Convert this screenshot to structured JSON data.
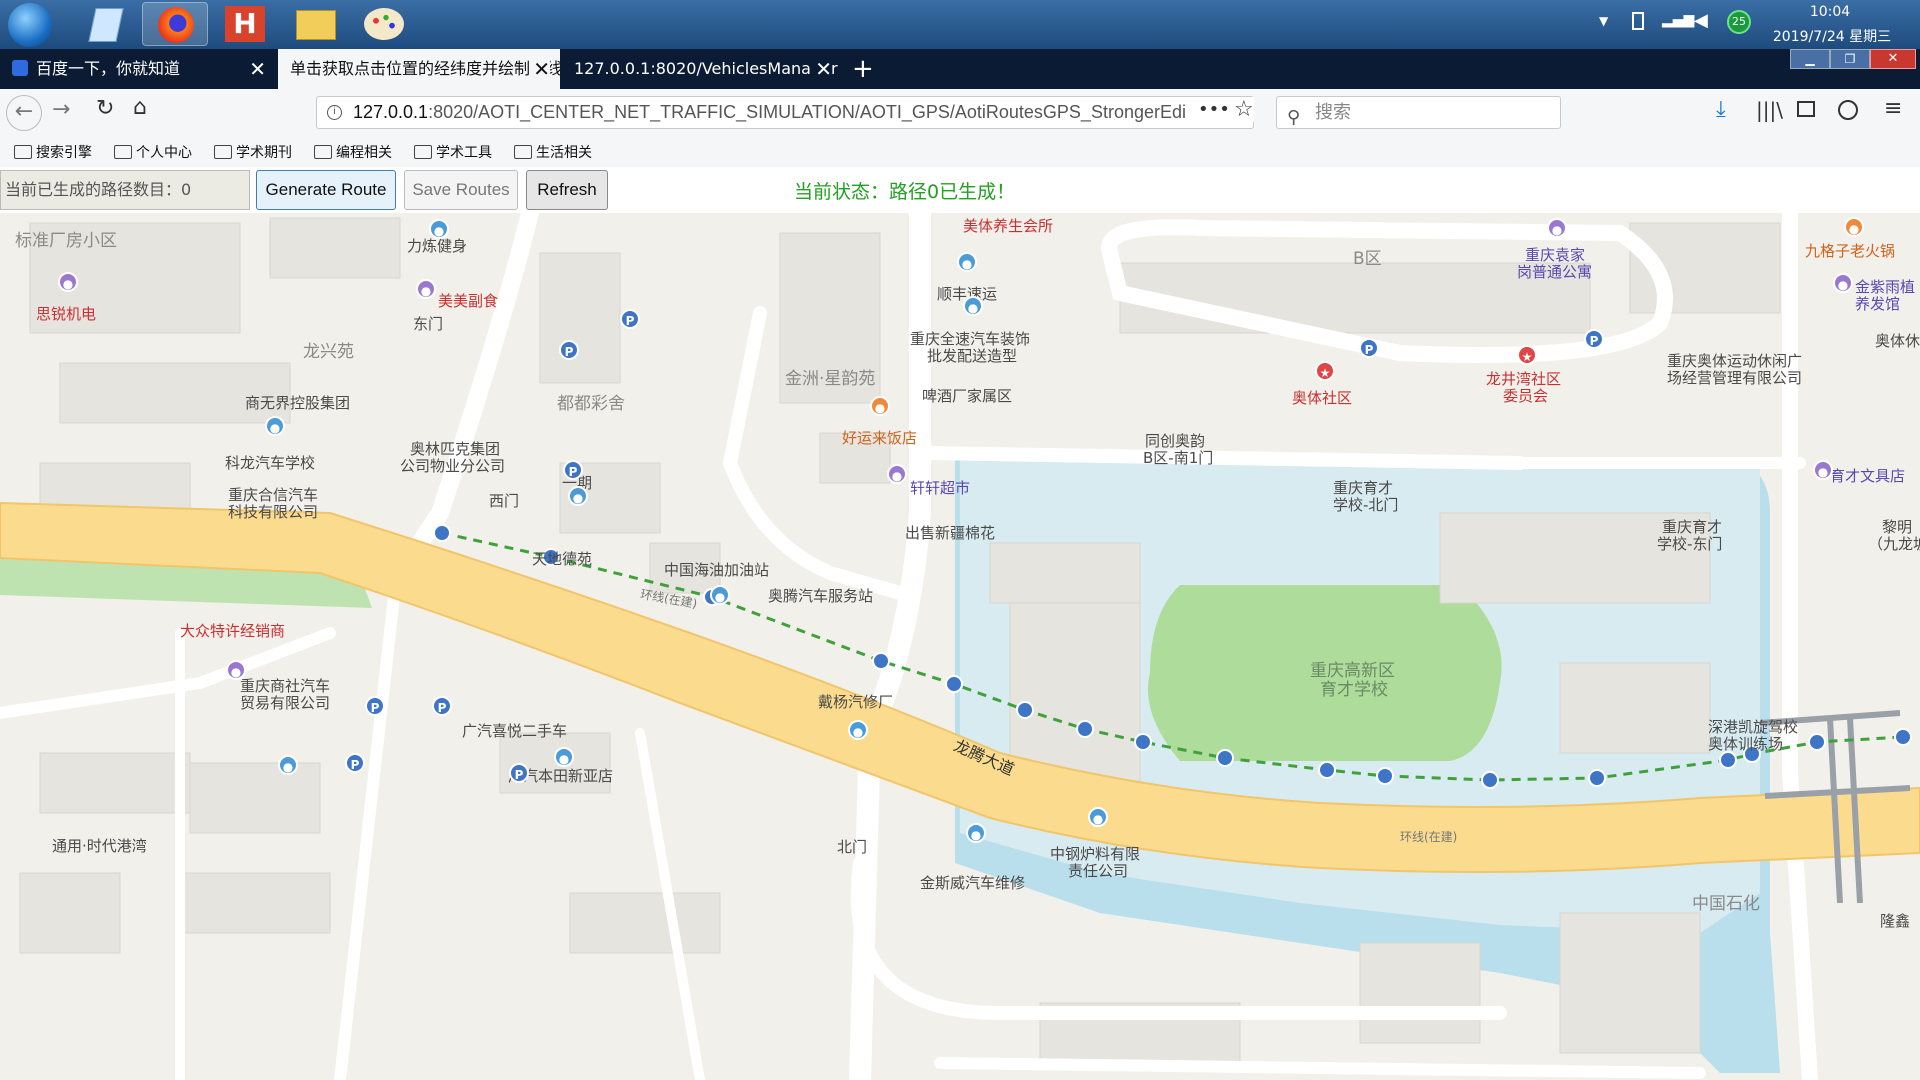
{
  "taskbar": {
    "clock_time": "10:04",
    "clock_date": "2019/7/24 星期三",
    "badge_count": "25"
  },
  "browser": {
    "tabs": [
      {
        "label": "百度一下，你就知道"
      },
      {
        "label": "单击获取点击位置的经纬度并绘制折线"
      },
      {
        "label": "127.0.0.1:8020/VehiclesManager"
      }
    ],
    "url_host": "127.0.0.1",
    "url_rest": ":8020/AOTI_CENTER_NET_TRAFFIC_SIMULATION/AOTI_GPS/AotiRoutesGPS_StrongerEdi",
    "search_placeholder": "搜索",
    "bookmarks": [
      "搜索引擎",
      "个人中心",
      "学术期刊",
      "编程相关",
      "学术工具",
      "生活相关"
    ]
  },
  "page": {
    "route_count_field": "当前已生成的路径数目：0",
    "generate_label": "Generate Route",
    "save_label": "Save Routes",
    "refresh_label": "Refresh",
    "status_text": "当前状态：路径0已生成！",
    "status_color": "#22a022"
  },
  "map": {
    "labels": {
      "l1": "标准厂房小区",
      "l2": "力炼健身",
      "l3": "美美副食",
      "l4": "东门",
      "l5": "思锐机电",
      "l6": "龙兴苑",
      "l7": "商无界控股集团",
      "l8": "科龙汽车学校",
      "l9": "奥林匹克集团",
      "l9b": "公司物业分公司",
      "l10": "一期",
      "l11": "西门",
      "l12": "重庆合信汽车",
      "l12b": "科技有限公司",
      "l13": "天地德苑",
      "l14": "大众特许经销商",
      "l15": "重庆商社汽车",
      "l15b": "贸易有限公司",
      "l16": "广汽喜悦二手车",
      "l17": "广汽本田新亚店",
      "l18": "通用·时代港湾",
      "l19": "都都彩舍",
      "l20": "金洲·星韵苑",
      "l21": "啤酒厂家属区",
      "l22": "好运来饭店",
      "l23": "轩轩超市",
      "l24": "出售新疆棉花",
      "l25": "中国海油加油站",
      "l26": "奥腾汽车服务站",
      "l27": "顺丰速运",
      "l28": "重庆全速汽车装饰",
      "l28b": "批发配送造型",
      "l29": "美体养生会所",
      "l30": "B区",
      "l31": "重庆袁家",
      "l31b": "岗普通公寓",
      "l32": "奥体社区",
      "l33": "龙井湾社区",
      "l33b": "委员会",
      "l34": "同创奥韵",
      "l34b": "B区-南1门",
      "l35": "重庆育才",
      "l35b": "学校-北门",
      "l36": "重庆高新区",
      "l36b": "育才学校",
      "l37": "九格子老火锅",
      "l38": "金紫雨植",
      "l38b": "养发馆",
      "l39": "重庆奥体运动休闲广",
      "l39b": "场经营管理有限公司",
      "l40": "奥体休",
      "l41": "育才文具店",
      "l42": "重庆育才",
      "l42b": "学校-东门",
      "l43": "黎明",
      "l43b": "（九龙坡",
      "l44": "深港凯旋驾校",
      "l44b": "奥体训练场",
      "l45": "戴杨汽修厂",
      "l46": "龙腾大道",
      "l47": "环线(在建)",
      "l48": "环线(在建)",
      "l49": "北门",
      "l50": "中钢炉料有限",
      "l50b": "责任公司",
      "l51": "金斯威汽车维修",
      "l52": "中国石化",
      "l53": "隆鑫"
    }
  }
}
